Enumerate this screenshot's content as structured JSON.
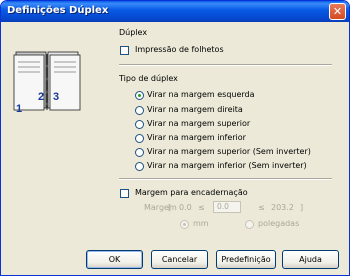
{
  "window": {
    "title": "Definições Dúplex"
  },
  "duplex": {
    "group_title": "Dúplex",
    "print_booklet_label": "Impressão de folhetos",
    "print_booklet_checked": false
  },
  "preview": {
    "page_numbers": [
      "1",
      "2",
      "3"
    ]
  },
  "duplex_type": {
    "group_title": "Tipo de dúplex",
    "options": [
      {
        "label": "Virar na margem esquerda",
        "selected": true
      },
      {
        "label": "Virar na margem direita",
        "selected": false
      },
      {
        "label": "Virar na margem superior",
        "selected": false
      },
      {
        "label": "Virar na margem inferior",
        "selected": false
      },
      {
        "label": "Virar na margem superior (Sem inverter)",
        "selected": false
      },
      {
        "label": "Virar na margem inferior (Sem inverter)",
        "selected": false
      }
    ]
  },
  "binding": {
    "checkbox_label": "Margem para encadernação",
    "checked": false,
    "margin_label": "Margem",
    "range_min": "0.0",
    "range_sep1": "≤",
    "value": "0.0",
    "range_sep2": "≤",
    "range_max": "203.2",
    "bracket_open": "[",
    "bracket_close": "]",
    "units": [
      {
        "label": "mm",
        "selected": true
      },
      {
        "label": "polegadas",
        "selected": false
      }
    ]
  },
  "buttons": {
    "ok": "OK",
    "cancel": "Cancelar",
    "default": "Predefinição",
    "help": "Ajuda"
  }
}
